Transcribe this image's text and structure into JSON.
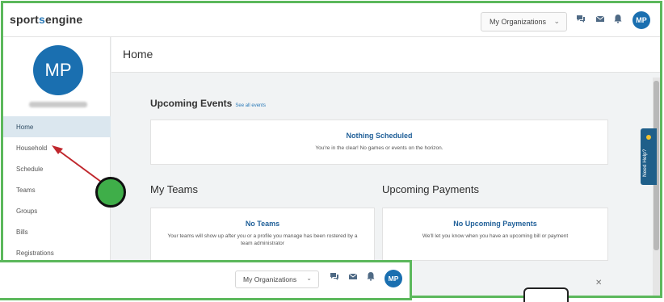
{
  "app": {
    "logo_prefix": "sport",
    "logo_accent": "s",
    "logo_suffix": "engine"
  },
  "header": {
    "org_dropdown": "My Organizations",
    "avatar_initials": "MP",
    "icons": [
      "chat-icon",
      "mail-icon",
      "bell-icon"
    ]
  },
  "sidebar": {
    "avatar_initials": "MP",
    "items": [
      {
        "label": "Home",
        "active": true
      },
      {
        "label": "Household",
        "active": false
      },
      {
        "label": "Schedule",
        "active": false
      },
      {
        "label": "Teams",
        "active": false
      },
      {
        "label": "Groups",
        "active": false
      },
      {
        "label": "Bills",
        "active": false
      },
      {
        "label": "Registrations",
        "active": false
      }
    ]
  },
  "page": {
    "title": "Home"
  },
  "upcoming_events": {
    "title": "Upcoming Events",
    "see_all": "See all events",
    "empty_title": "Nothing Scheduled",
    "empty_text": "You're in the clear! No games or events on the horizon."
  },
  "my_teams": {
    "title": "My Teams",
    "empty_title": "No Teams",
    "empty_text": "Your teams will show up after you or a profile you manage has been rostered by a team administrator"
  },
  "upcoming_payments": {
    "title": "Upcoming Payments",
    "empty_title": "No Upcoming Payments",
    "empty_text": "We'll let you know when you have an upcoming bill or payment"
  },
  "help": {
    "label": "Need Help?"
  },
  "overlay": {
    "org_dropdown": "My Organizations",
    "avatar_initials": "MP"
  },
  "colors": {
    "accent": "#1a6fb0",
    "highlight_frame": "#5cb85c",
    "marker": "#3fae49",
    "arrow": "#c0272d"
  }
}
